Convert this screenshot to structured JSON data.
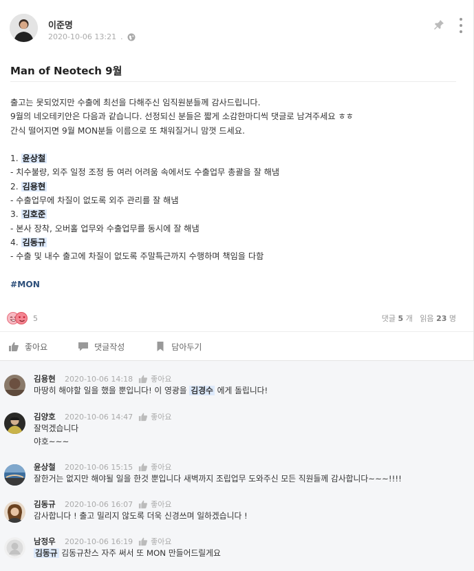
{
  "post": {
    "author": "이준명",
    "timestamp": "2020-10-06 13:21",
    "visibility_icon": "globe-icon",
    "title": "Man of Neotech 9월",
    "intro": [
      "출고는 못되었지만 수출에 최선을 다해주신 임직원분들께 감사드립니다.",
      "9월의 네오테키안은 다음과 같습니다. 선정되신 분들은 짧게 소감한마디씩 댓글로 남겨주세요 ㅎㅎ",
      "간식 떨어지면 9월 MON분들 이름으로 또 채워질거니 맘껏 드세요."
    ],
    "winners": [
      {
        "num": "1.",
        "name": "윤상철",
        "desc": "- 치수불량, 외주 일정 조정 등 여러 어려움 속에서도 수출업무 총괄을 잘 해냄"
      },
      {
        "num": "2.",
        "name": "김용현",
        "desc": "- 수출업무에 차질이 없도록 외주 관리를 잘 해냄"
      },
      {
        "num": "3.",
        "name": "김호준",
        "desc": "- 본사 장착, 오버홀 업무와 수출업무를 동시에 잘 해냄"
      },
      {
        "num": "4.",
        "name": "김동규",
        "desc": "- 수출 및 내수 출고에 차질이 없도록 주말특근까지 수행하며 책임을 다함"
      }
    ],
    "hashtag": "#MON",
    "reaction_count": "5",
    "stats": {
      "comments_label": "댓글",
      "comments_value": "5",
      "comments_unit": "개",
      "views_label": "읽음",
      "views_value": "23",
      "views_unit": "명"
    },
    "actions": {
      "like": "좋아요",
      "comment": "댓글작성",
      "bookmark": "담아두기"
    }
  },
  "comments": [
    {
      "author": "김용현",
      "timestamp": "2020-10-06 14:18",
      "like": "좋아요",
      "text_before": "마땅히 해야할 일을 했을 뿐입니다! 이 영광을 ",
      "mention": "김경수",
      "text_after": " 에게 돌립니다!"
    },
    {
      "author": "김양호",
      "timestamp": "2020-10-06 14:47",
      "like": "좋아요",
      "line1": "잘먹겠습니다",
      "line2": "야호~~~"
    },
    {
      "author": "윤상철",
      "timestamp": "2020-10-06 15:15",
      "like": "좋아요",
      "text": "잘한거는 없지만 해야될 일을 한것 뿐입니다 새벽까지 조립업무 도와주신 모든 직원들께 감사합니다~~~!!!!"
    },
    {
      "author": "김동규",
      "timestamp": "2020-10-06 16:07",
      "like": "좋아요",
      "text": "감사합니다 ! 출고 밀리지 않도록 더욱 신경쓰며 일하겠습니다 !"
    },
    {
      "author": "남정우",
      "timestamp": "2020-10-06 16:19",
      "like": "좋아요",
      "mention": "김동규",
      "text_after": " 김동규찬스 자주 써서 또 MON 만들어드릴게요"
    }
  ],
  "colors": {
    "mention_bg": "#dce9fb",
    "hashtag": "#2d4f7a",
    "comments_bg": "#f5f6f8"
  }
}
